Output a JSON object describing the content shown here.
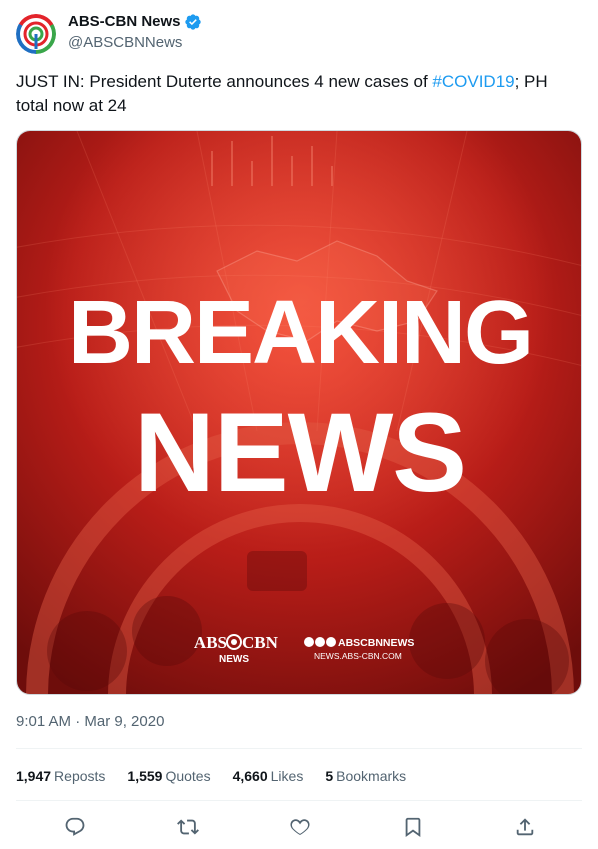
{
  "author": {
    "name": "ABS-CBN News",
    "handle": "@ABSCBNNews"
  },
  "tweet": {
    "text_before": "JUST IN: President Duterte announces 4 new cases of ",
    "hashtag": "#COVID19",
    "text_after": "; PH total now at 24"
  },
  "media": {
    "headline_line1": "BREAKING",
    "headline_line2": "NEWS",
    "logo_abs": "ABS",
    "logo_cbn": "CBN",
    "logo_news": "NEWS",
    "social_handle": "ABSCBNNEWS",
    "site": "NEWS.ABS-CBN.COM"
  },
  "timestamp": "9:01 AM · Mar 9, 2020",
  "stats": [
    {
      "count": "1,947",
      "label": "Reposts"
    },
    {
      "count": "1,559",
      "label": "Quotes"
    },
    {
      "count": "4,660",
      "label": "Likes"
    },
    {
      "count": "5",
      "label": "Bookmarks"
    }
  ],
  "colors": {
    "accent": "#1d9bf0",
    "media_red": "#c8211c",
    "verified": "#1d9bf0"
  },
  "icons": [
    "reply-icon",
    "repost-icon",
    "like-icon",
    "bookmark-icon",
    "share-icon"
  ]
}
